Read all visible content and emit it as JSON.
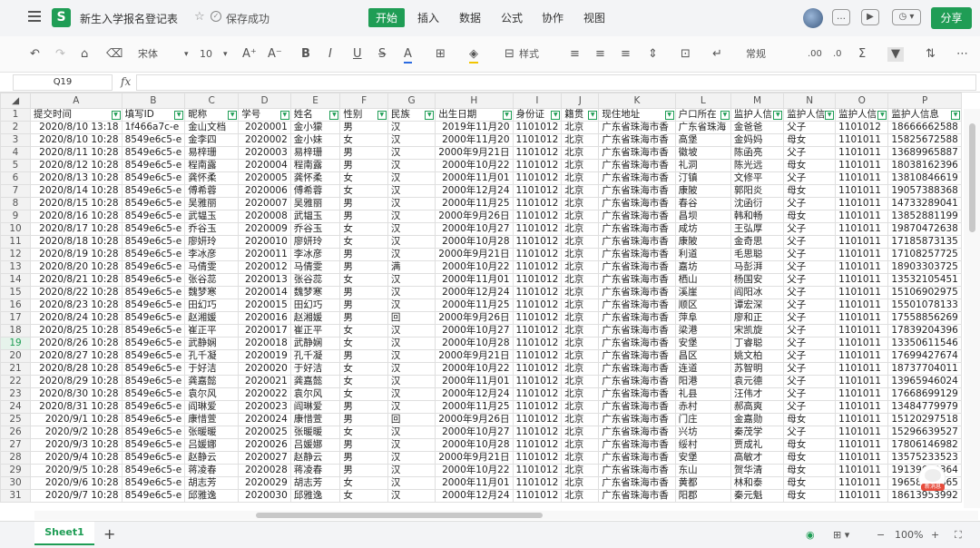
{
  "app": {
    "logo_letter": "S",
    "doc_title": "新生入学报名登记表",
    "save_status": "保存成功",
    "menus": [
      "开始",
      "插入",
      "数据",
      "公式",
      "协作",
      "视图"
    ],
    "active_menu": "开始",
    "share_label": "分享"
  },
  "toolbar": {
    "font_name": "宋体",
    "font_size": "10",
    "style_label": "样式",
    "number_format": "常规",
    "sigma": "Σ"
  },
  "formula_bar": {
    "name_box": "Q19",
    "fx_label": "fx",
    "content": ""
  },
  "grid": {
    "columns": [
      "A",
      "B",
      "C",
      "D",
      "E",
      "F",
      "G",
      "H",
      "I",
      "J",
      "K",
      "L",
      "M",
      "N",
      "O",
      "P"
    ],
    "selected_row": "19",
    "header_row": [
      "提交时间",
      "填写ID",
      "昵称",
      "学号",
      "姓名",
      "性别",
      "民族",
      "出生日期",
      "身份证",
      "籍贯",
      "现住地址",
      "户口所在",
      "监护人信",
      "监护人信",
      "监护人信",
      "监护人信息"
    ],
    "rows": [
      [
        "2",
        "2020/8/10 13:18",
        "1f466a7c-e",
        "金山文档",
        "2020001",
        "金小獴",
        "男",
        "汉",
        "2019年11月20",
        "1101012",
        "北京",
        "广东省珠海市香",
        "广东省珠海",
        "金爸爸",
        "父子",
        "1101012",
        "18666662588"
      ],
      [
        "3",
        "2020/8/10 10:28",
        "8549e6c5-e",
        "金李四",
        "2020002",
        "金小妹",
        "女",
        "汉",
        "2000年11月20",
        "1101012",
        "北京",
        "广东省珠海市香",
        "高堡",
        "金妈妈",
        "母女",
        "1101011",
        "15825672588"
      ],
      [
        "4",
        "2020/8/11 10:28",
        "8549e6c5-e",
        "易梓珊",
        "2020003",
        "易梓珊",
        "男",
        "汉",
        "2000年9月21日",
        "1101012",
        "北京",
        "广东省珠海市香",
        "徽坡",
        "陈函亮",
        "父子",
        "1101011",
        "13689965887"
      ],
      [
        "5",
        "2020/8/12 10:28",
        "8549e6c5-e",
        "程南露",
        "2020004",
        "程南露",
        "男",
        "汉",
        "2000年10月22",
        "1101012",
        "北京",
        "广东省珠海市香",
        "礼洞",
        "陈光远",
        "母女",
        "1101011",
        "18038162396"
      ],
      [
        "6",
        "2020/8/13 10:28",
        "8549e6c5-e",
        "龚怀柔",
        "2020005",
        "龚怀柔",
        "女",
        "汉",
        "2000年11月01",
        "1101012",
        "北京",
        "广东省珠海市香",
        "汀镇",
        "文修平",
        "父子",
        "1101011",
        "13810846619"
      ],
      [
        "7",
        "2020/8/14 10:28",
        "8549e6c5-e",
        "傅希蓉",
        "2020006",
        "傅希蓉",
        "女",
        "汉",
        "2000年12月24",
        "1101012",
        "北京",
        "广东省珠海市香",
        "康陂",
        "郭阳炎",
        "母女",
        "1101011",
        "19057388368"
      ],
      [
        "8",
        "2020/8/15 10:28",
        "8549e6c5-e",
        "吴雅丽",
        "2020007",
        "吴雅丽",
        "男",
        "汉",
        "2000年11月25",
        "1101012",
        "北京",
        "广东省珠海市香",
        "春谷",
        "沈函衍",
        "父子",
        "1101011",
        "14733289041"
      ],
      [
        "9",
        "2020/8/16 10:28",
        "8549e6c5-e",
        "武韫玉",
        "2020008",
        "武韫玉",
        "男",
        "汉",
        "2000年9月26日",
        "1101012",
        "北京",
        "广东省珠海市香",
        "昌坝",
        "韩和畅",
        "母女",
        "1101011",
        "13852881199"
      ],
      [
        "10",
        "2020/8/17 10:28",
        "8549e6c5-e",
        "乔谷玉",
        "2020009",
        "乔谷玉",
        "女",
        "汉",
        "2000年10月27",
        "1101012",
        "北京",
        "广东省珠海市香",
        "咸坊",
        "王弘厚",
        "父子",
        "1101011",
        "19870472638"
      ],
      [
        "11",
        "2020/8/18 10:28",
        "8549e6c5-e",
        "廖妍玲",
        "2020010",
        "廖妍玲",
        "女",
        "汉",
        "2000年10月28",
        "1101012",
        "北京",
        "广东省珠海市香",
        "康陂",
        "金奇思",
        "父子",
        "1101011",
        "17185873135"
      ],
      [
        "12",
        "2020/8/19 10:28",
        "8549e6c5-e",
        "李冰彦",
        "2020011",
        "李冰彦",
        "男",
        "汉",
        "2000年9月21日",
        "1101012",
        "北京",
        "广东省珠海市香",
        "利道",
        "毛思聪",
        "父子",
        "1101011",
        "17108257725"
      ],
      [
        "13",
        "2020/8/20 10:28",
        "8549e6c5-e",
        "马倩雯",
        "2020012",
        "马倩雯",
        "男",
        "满",
        "2000年10月22",
        "1101012",
        "北京",
        "广东省珠海市香",
        "嘉坊",
        "马彭湃",
        "父子",
        "1101011",
        "18903303725"
      ],
      [
        "14",
        "2020/8/21 10:28",
        "8549e6c5-e",
        "张谷蕊",
        "2020013",
        "张谷蕊",
        "女",
        "汉",
        "2000年11月01",
        "1101012",
        "北京",
        "广东省珠海市香",
        "栖山",
        "杨国安",
        "父子",
        "1101011",
        "13532105451"
      ],
      [
        "15",
        "2020/8/22 10:28",
        "8549e6c5-e",
        "魏梦寒",
        "2020014",
        "魏梦寒",
        "男",
        "汉",
        "2000年12月24",
        "1101012",
        "北京",
        "广东省珠海市香",
        "溪崖",
        "阎阳冰",
        "父子",
        "1101011",
        "15106902975"
      ],
      [
        "16",
        "2020/8/23 10:28",
        "8549e6c5-e",
        "田幻巧",
        "2020015",
        "田幻巧",
        "男",
        "汉",
        "2000年11月25",
        "1101012",
        "北京",
        "广东省珠海市香",
        "顺区",
        "谭宏深",
        "父子",
        "1101011",
        "15501078133"
      ],
      [
        "17",
        "2020/8/24 10:28",
        "8549e6c5-e",
        "赵湘媛",
        "2020016",
        "赵湘媛",
        "男",
        "回",
        "2000年9月26日",
        "1101012",
        "北京",
        "广东省珠海市香",
        "萍阜",
        "廖和正",
        "父子",
        "1101011",
        "17558856269"
      ],
      [
        "18",
        "2020/8/25 10:28",
        "8549e6c5-e",
        "崔正平",
        "2020017",
        "崔正平",
        "女",
        "汉",
        "2000年10月27",
        "1101012",
        "北京",
        "广东省珠海市香",
        "梁港",
        "宋凯旋",
        "父子",
        "1101011",
        "17839204396"
      ],
      [
        "19",
        "2020/8/26 10:28",
        "8549e6c5-e",
        "武静娴",
        "2020018",
        "武静娴",
        "女",
        "汉",
        "2000年10月28",
        "1101012",
        "北京",
        "广东省珠海市香",
        "安堡",
        "丁睿聪",
        "父子",
        "1101011",
        "13350611546"
      ],
      [
        "20",
        "2020/8/27 10:28",
        "8549e6c5-e",
        "孔千凝",
        "2020019",
        "孔千凝",
        "男",
        "汉",
        "2000年9月21日",
        "1101012",
        "北京",
        "广东省珠海市香",
        "昌区",
        "姚文柏",
        "父子",
        "1101011",
        "17699427674"
      ],
      [
        "21",
        "2020/8/28 10:28",
        "8549e6c5-e",
        "于好洁",
        "2020020",
        "于好洁",
        "女",
        "汉",
        "2000年10月22",
        "1101012",
        "北京",
        "广东省珠海市香",
        "连道",
        "苏智明",
        "父子",
        "1101011",
        "18737704011"
      ],
      [
        "22",
        "2020/8/29 10:28",
        "8549e6c5-e",
        "龚嘉懿",
        "2020021",
        "龚嘉懿",
        "女",
        "汉",
        "2000年11月01",
        "1101012",
        "北京",
        "广东省珠海市香",
        "阳港",
        "袁元德",
        "父子",
        "1101011",
        "13965946024"
      ],
      [
        "23",
        "2020/8/30 10:28",
        "8549e6c5-e",
        "袁尔风",
        "2020022",
        "袁尔风",
        "女",
        "汉",
        "2000年12月24",
        "1101012",
        "北京",
        "广东省珠海市香",
        "礼县",
        "汪伟才",
        "父子",
        "1101011",
        "17668699129"
      ],
      [
        "24",
        "2020/8/31 10:28",
        "8549e6c5-e",
        "阎琳爱",
        "2020023",
        "阎琳爱",
        "男",
        "汉",
        "2000年11月25",
        "1101012",
        "北京",
        "广东省珠海市香",
        "赤村",
        "郝高爽",
        "父子",
        "1101011",
        "13484779979"
      ],
      [
        "25",
        "2020/9/1 10:28",
        "8549e6c5-e",
        "康惜萱",
        "2020024",
        "康惜萱",
        "男",
        "回",
        "2000年9月26日",
        "1101012",
        "北京",
        "广东省珠海市香",
        "门庄",
        "金嘉勋",
        "母女",
        "1101011",
        "15120297518"
      ],
      [
        "26",
        "2020/9/2 10:28",
        "8549e6c5-e",
        "张暖暖",
        "2020025",
        "张暖暖",
        "女",
        "汉",
        "2000年10月27",
        "1101012",
        "北京",
        "广东省珠海市香",
        "兴坊",
        "秦茂学",
        "父子",
        "1101011",
        "15296639527"
      ],
      [
        "27",
        "2020/9/3 10:28",
        "8549e6c5-e",
        "吕媛娜",
        "2020026",
        "吕媛娜",
        "男",
        "汉",
        "2000年10月28",
        "1101012",
        "北京",
        "广东省珠海市香",
        "绥村",
        "贾成礼",
        "母女",
        "1101011",
        "17806146982"
      ],
      [
        "28",
        "2020/9/4 10:28",
        "8549e6c5-e",
        "赵静云",
        "2020027",
        "赵静云",
        "男",
        "汉",
        "2000年9月21日",
        "1101012",
        "北京",
        "广东省珠海市香",
        "安堡",
        "高敏才",
        "母女",
        "1101011",
        "13575233523"
      ],
      [
        "29",
        "2020/9/5 10:28",
        "8549e6c5-e",
        "蒋凌春",
        "2020028",
        "蒋凌春",
        "男",
        "汉",
        "2000年10月22",
        "1101012",
        "北京",
        "广东省珠海市香",
        "东山",
        "贺华清",
        "母女",
        "1101011",
        "19139639364"
      ],
      [
        "30",
        "2020/9/6 10:28",
        "8549e6c5-e",
        "胡志芳",
        "2020029",
        "胡志芳",
        "女",
        "汉",
        "2000年11月01",
        "1101012",
        "北京",
        "广东省珠海市香",
        "黄都",
        "林和泰",
        "母女",
        "1101011",
        "19658655865"
      ],
      [
        "31",
        "2020/9/7 10:28",
        "8549e6c5-e",
        "邱雅逸",
        "2020030",
        "邱雅逸",
        "女",
        "汉",
        "2000年12月24",
        "1101012",
        "北京",
        "广东省珠海市香",
        "阳郡",
        "秦元魁",
        "母女",
        "1101011",
        "18613953992"
      ]
    ]
  },
  "status": {
    "sheet_tab": "Sheet1",
    "zoom": "100%"
  },
  "bot_badge": "新消息",
  "colors": {
    "brand": "#1f9d55"
  }
}
